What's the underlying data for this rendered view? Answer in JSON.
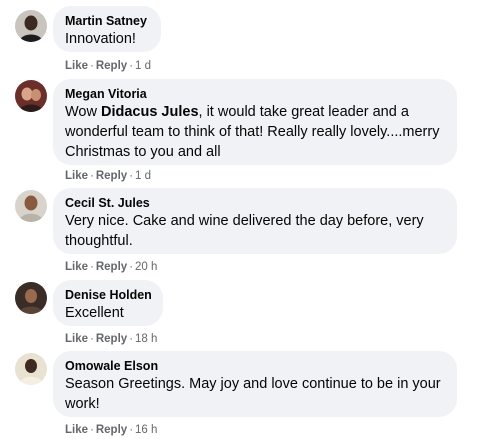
{
  "comments": [
    {
      "author": "Martin Satney",
      "text": "Innovation!",
      "like": "Like",
      "reply": "Reply",
      "time": "1 d",
      "sep": "·"
    },
    {
      "author": "Megan Vitoria",
      "text_before": "Wow ",
      "mention": "Didacus Jules",
      "text_after": ", it would take great leader and a wonderful team to think of that! Really really lovely....merry Christmas to you and all",
      "like": "Like",
      "reply": "Reply",
      "time": "1 d",
      "sep": "·"
    },
    {
      "author": "Cecil St. Jules",
      "text": "Very nice. Cake and wine delivered the day before, very thoughtful.",
      "like": "Like",
      "reply": "Reply",
      "time": "20 h",
      "sep": "·"
    },
    {
      "author": "Denise Holden",
      "text": "Excellent",
      "like": "Like",
      "reply": "Reply",
      "time": "18 h",
      "sep": "·"
    },
    {
      "author": "Omowale Elson",
      "text": "Season Greetings. May joy and love continue to be in your work!",
      "like": "Like",
      "reply": "Reply",
      "time": "16 h",
      "sep": "·"
    }
  ],
  "colors": {
    "bubble": "#f0f2f5",
    "meta": "#65676b",
    "text": "#050505"
  }
}
